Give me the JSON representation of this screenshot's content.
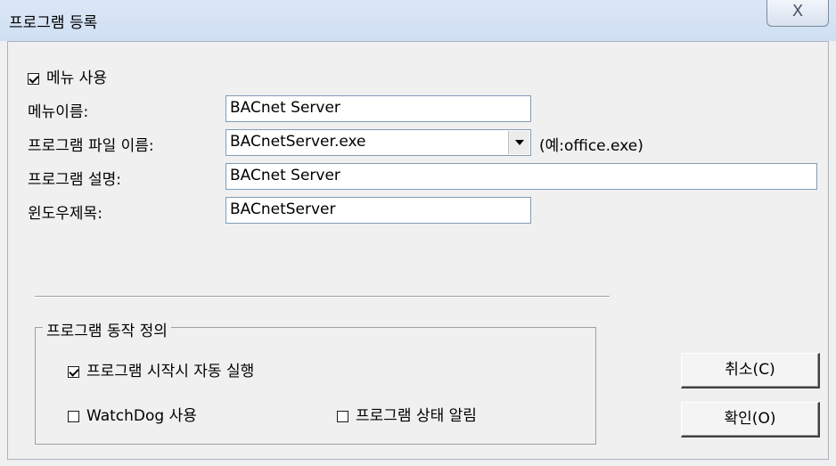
{
  "window": {
    "title": "프로그램 등록",
    "close_glyph": "X"
  },
  "menu": {
    "use_menu": {
      "label": "메뉴 사용",
      "checked": true
    },
    "menu_name": {
      "label": "메뉴이름:",
      "value": "BACnet Server"
    },
    "program_file": {
      "label": "프로그램 파일 이름:",
      "value": "BACnetServer.exe",
      "hint": "(예:office.exe)"
    },
    "program_desc": {
      "label": "프로그램 설명:",
      "value": "BACnet Server"
    },
    "window_title": {
      "label": "윈도우제목:",
      "value": "BACnetServer"
    }
  },
  "behavior": {
    "group_title": "프로그램 동작 정의",
    "auto_run": {
      "label": "프로그램 시작시 자동 실행",
      "checked": true
    },
    "watchdog": {
      "label": "WatchDog 사용",
      "checked": false
    },
    "status_notify": {
      "label": "프로그램 상태 알림",
      "checked": false
    }
  },
  "buttons": {
    "cancel": "취소(C)",
    "ok": "확인(O)"
  },
  "icons": {
    "close": "close-icon",
    "dropdown": "chevron-down-icon",
    "check": "checkmark-icon"
  }
}
